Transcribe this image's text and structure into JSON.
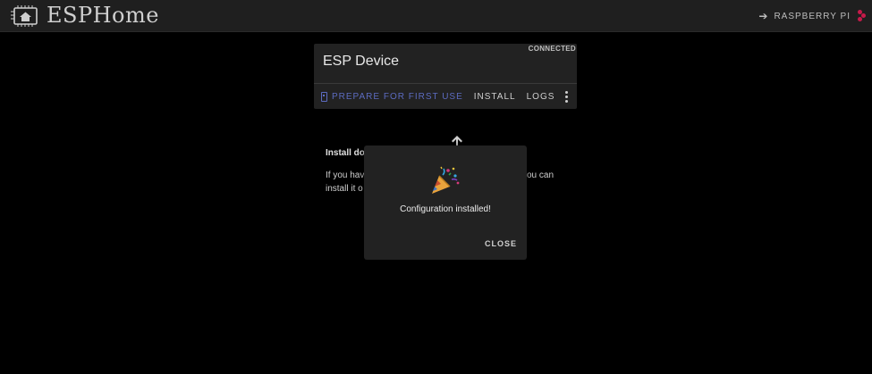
{
  "header": {
    "title": "ESPHome",
    "link_label": "RASPBERRY PI"
  },
  "device_card": {
    "status": "CONNECTED",
    "name": "ESP Device",
    "actions": {
      "prepare": "PREPARE FOR FIRST USE",
      "install": "INSTALL",
      "logs": "LOGS"
    }
  },
  "background": {
    "heading": "Install do",
    "line1_left": "If you hav",
    "line1_right": "ou can",
    "line2": "install it o"
  },
  "dialog": {
    "message": "Configuration installed!",
    "close_label": "CLOSE",
    "icon": "party-popper-icon"
  },
  "colors": {
    "accent": "#5c6bc0",
    "background": "#000000",
    "card": "#222222",
    "header": "#1f1f1f"
  }
}
